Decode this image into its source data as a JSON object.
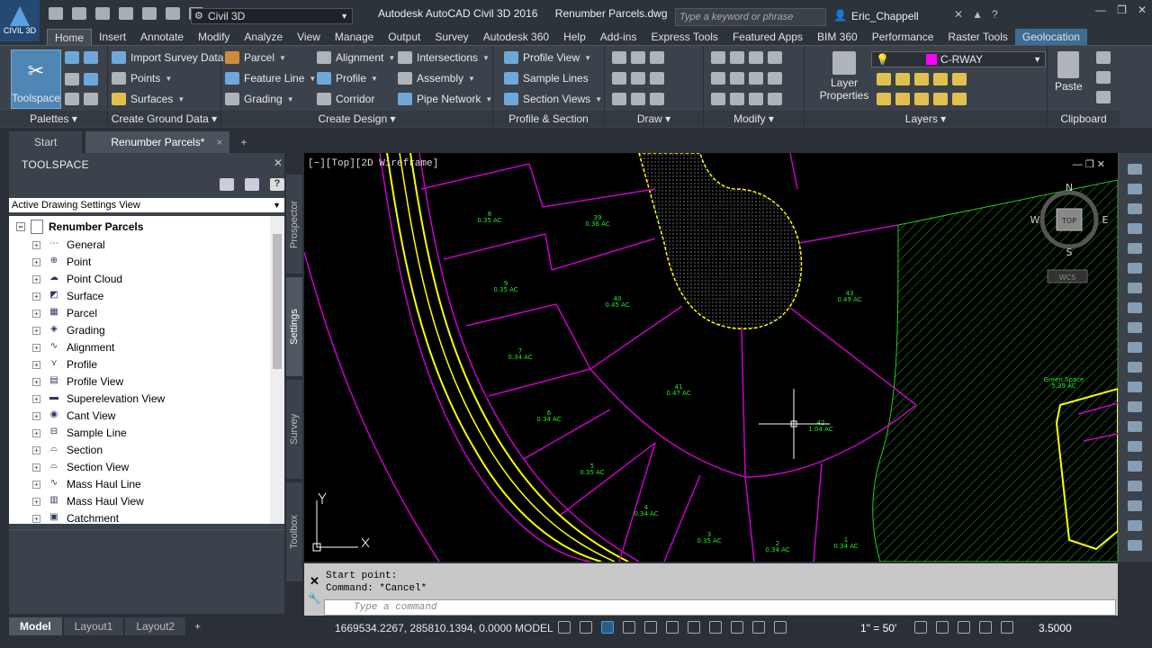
{
  "app": {
    "title": "Autodesk AutoCAD Civil 3D 2016",
    "document": "Renumber Parcels.dwg",
    "logo_label": "CIVIL 3D"
  },
  "workspace": {
    "value": "Civil 3D"
  },
  "search": {
    "placeholder": "Type a keyword or phrase"
  },
  "user": {
    "name": "Eric_Chappell"
  },
  "ribbon_tabs": [
    "Home",
    "Insert",
    "Annotate",
    "Modify",
    "Analyze",
    "View",
    "Manage",
    "Output",
    "Survey",
    "Autodesk 360",
    "Help",
    "Add-ins",
    "Express Tools",
    "Featured Apps",
    "BIM 360",
    "Performance",
    "Raster Tools",
    "Geolocation"
  ],
  "ribbon": {
    "toolspace": "Toolspace",
    "palettes": "Palettes",
    "create_ground": {
      "title": "Create Ground Data",
      "items": [
        "Import Survey Data",
        "Points",
        "Surfaces"
      ]
    },
    "create_design": {
      "title": "Create Design",
      "items": [
        "Parcel",
        "Feature Line",
        "Grading",
        "Alignment",
        "Profile",
        "Corridor",
        "Intersections",
        "Assembly",
        "Pipe Network"
      ]
    },
    "profile_section": {
      "title": "Profile & Section Views",
      "items": [
        "Profile View",
        "Sample Lines",
        "Section Views"
      ]
    },
    "draw": {
      "title": "Draw"
    },
    "modify": {
      "title": "Modify"
    },
    "layers": {
      "title": "Layers",
      "layer_properties": "Layer Properties",
      "current_layer": "C-RWAY",
      "layer_color": "#ff00ff"
    },
    "clipboard": {
      "title": "Clipboard",
      "paste": "Paste"
    }
  },
  "file_tabs": [
    {
      "label": "Start"
    },
    {
      "label": "Renumber Parcels*"
    }
  ],
  "toolspace": {
    "title": "TOOLSPACE",
    "view_select": "Active Drawing Settings View",
    "root": "Renumber Parcels",
    "nodes": [
      "General",
      "Point",
      "Point Cloud",
      "Surface",
      "Parcel",
      "Grading",
      "Alignment",
      "Profile",
      "Profile View",
      "Superelevation View",
      "Cant View",
      "Sample Line",
      "Section",
      "Section View",
      "Mass Haul Line",
      "Mass Haul View",
      "Catchment"
    ],
    "vertical_tabs": [
      "Prospector",
      "Settings",
      "Survey",
      "Toolbox"
    ]
  },
  "viewport": {
    "label": "[−][Top][2D Wireframe]",
    "viewcube": {
      "n": "N",
      "s": "S",
      "e": "E",
      "w": "W",
      "top": "TOP",
      "wcs": "WCS"
    },
    "parcels": [
      {
        "num": "8",
        "area": "0.35 AC"
      },
      {
        "num": "39",
        "area": "0.36 AC"
      },
      {
        "num": "9",
        "area": "0.35 AC"
      },
      {
        "num": "40",
        "area": "0.45 AC"
      },
      {
        "num": "7",
        "area": "0.34 AC"
      },
      {
        "num": "41",
        "area": "0.47 AC"
      },
      {
        "num": "6",
        "area": "0.34 AC"
      },
      {
        "num": "5",
        "area": "0.35 AC"
      },
      {
        "num": "4",
        "area": "0.34 AC"
      },
      {
        "num": "3",
        "area": "0.35 AC"
      },
      {
        "num": "2",
        "area": "0.34 AC"
      },
      {
        "num": "1",
        "area": "0.34 AC"
      },
      {
        "num": "42",
        "area": "1.04 AC"
      },
      {
        "num": "43",
        "area": "0.49 AC"
      }
    ],
    "green_space": {
      "name": "Green Space",
      "area": "5.39 AC"
    }
  },
  "command": {
    "history": [
      "Start point:",
      "Command: *Cancel*"
    ],
    "placeholder": "Type a command"
  },
  "status": {
    "layouts": [
      "Model",
      "Layout1",
      "Layout2"
    ],
    "coordinates": "1669534.2267, 285810.1394, 0.0000",
    "space": "MODEL",
    "scale": "1\" = 50'",
    "zoom": "3.5000"
  }
}
